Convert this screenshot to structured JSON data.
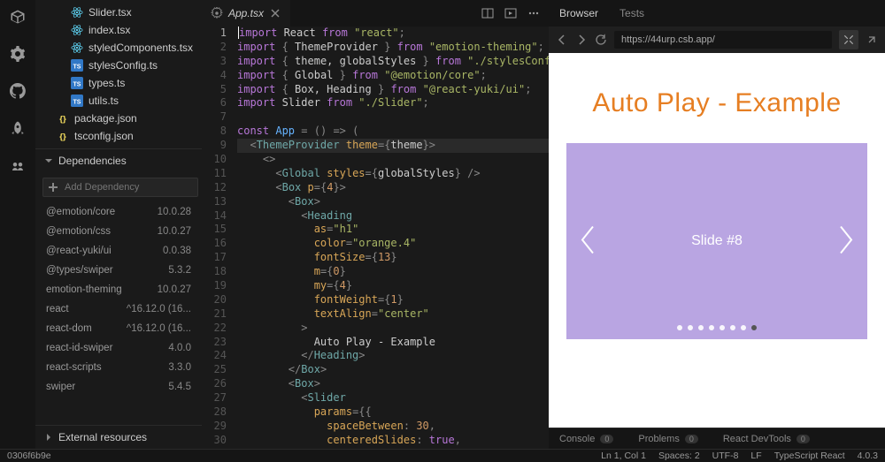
{
  "files": [
    {
      "name": "Slider.tsx",
      "type": "react"
    },
    {
      "name": "index.tsx",
      "type": "react"
    },
    {
      "name": "styledComponents.tsx",
      "type": "react"
    },
    {
      "name": "stylesConfig.ts",
      "type": "ts"
    },
    {
      "name": "types.ts",
      "type": "ts"
    },
    {
      "name": "utils.ts",
      "type": "ts"
    },
    {
      "name": "package.json",
      "type": "json",
      "lessIndent": true
    },
    {
      "name": "tsconfig.json",
      "type": "json",
      "lessIndent": true
    }
  ],
  "sections": {
    "deps": "Dependencies",
    "external": "External resources"
  },
  "depSearch": {
    "placeholder": "Add Dependency"
  },
  "dependencies": [
    {
      "name": "@emotion/core",
      "version": "10.0.28"
    },
    {
      "name": "@emotion/css",
      "version": "10.0.27"
    },
    {
      "name": "@react-yuki/ui",
      "version": "0.0.38"
    },
    {
      "name": "@types/swiper",
      "version": "5.3.2"
    },
    {
      "name": "emotion-theming",
      "version": "10.0.27"
    },
    {
      "name": "react",
      "version": "^16.12.0 (16..."
    },
    {
      "name": "react-dom",
      "version": "^16.12.0 (16..."
    },
    {
      "name": "react-id-swiper",
      "version": "4.0.0"
    },
    {
      "name": "react-scripts",
      "version": "3.3.0"
    },
    {
      "name": "swiper",
      "version": "5.4.5"
    }
  ],
  "tab": {
    "name": "App.tsx"
  },
  "code_lines": [
    [
      [
        "kw",
        "import"
      ],
      [
        "plain",
        " React "
      ],
      [
        "kw",
        "from"
      ],
      [
        "plain",
        " "
      ],
      [
        "str",
        "\"react\""
      ],
      [
        "punc",
        ";"
      ]
    ],
    [
      [
        "kw",
        "import"
      ],
      [
        "plain",
        " "
      ],
      [
        "punc",
        "{"
      ],
      [
        "plain",
        " ThemeProvider "
      ],
      [
        "punc",
        "}"
      ],
      [
        "plain",
        " "
      ],
      [
        "kw",
        "from"
      ],
      [
        "plain",
        " "
      ],
      [
        "str",
        "\"emotion-theming\""
      ],
      [
        "punc",
        ";"
      ]
    ],
    [
      [
        "kw",
        "import"
      ],
      [
        "plain",
        " "
      ],
      [
        "punc",
        "{"
      ],
      [
        "plain",
        " theme, globalStyles "
      ],
      [
        "punc",
        "}"
      ],
      [
        "plain",
        " "
      ],
      [
        "kw",
        "from"
      ],
      [
        "plain",
        " "
      ],
      [
        "str",
        "\"./stylesConfig\""
      ],
      [
        "punc",
        ";"
      ]
    ],
    [
      [
        "kw",
        "import"
      ],
      [
        "plain",
        " "
      ],
      [
        "punc",
        "{"
      ],
      [
        "plain",
        " Global "
      ],
      [
        "punc",
        "}"
      ],
      [
        "plain",
        " "
      ],
      [
        "kw",
        "from"
      ],
      [
        "plain",
        " "
      ],
      [
        "str",
        "\"@emotion/core\""
      ],
      [
        "punc",
        ";"
      ]
    ],
    [
      [
        "kw",
        "import"
      ],
      [
        "plain",
        " "
      ],
      [
        "punc",
        "{"
      ],
      [
        "plain",
        " Box, Heading "
      ],
      [
        "punc",
        "}"
      ],
      [
        "plain",
        " "
      ],
      [
        "kw",
        "from"
      ],
      [
        "plain",
        " "
      ],
      [
        "str",
        "\"@react-yuki/ui\""
      ],
      [
        "punc",
        ";"
      ]
    ],
    [
      [
        "kw",
        "import"
      ],
      [
        "plain",
        " Slider "
      ],
      [
        "kw",
        "from"
      ],
      [
        "plain",
        " "
      ],
      [
        "str",
        "\"./Slider\""
      ],
      [
        "punc",
        ";"
      ]
    ],
    [
      [
        "plain",
        ""
      ]
    ],
    [
      [
        "kw",
        "const"
      ],
      [
        "plain",
        " "
      ],
      [
        "fn",
        "App"
      ],
      [
        "plain",
        " "
      ],
      [
        "punc",
        "="
      ],
      [
        "plain",
        " "
      ],
      [
        "punc",
        "()"
      ],
      [
        "plain",
        " "
      ],
      [
        "punc",
        "=>"
      ],
      [
        "plain",
        " "
      ],
      [
        "punc",
        "("
      ]
    ],
    [
      [
        "plain",
        "  "
      ],
      [
        "punc",
        "<"
      ],
      [
        "comp",
        "ThemeProvider"
      ],
      [
        "plain",
        " "
      ],
      [
        "attr",
        "theme"
      ],
      [
        "punc",
        "={"
      ],
      [
        "plain",
        "theme"
      ],
      [
        "punc",
        "}>"
      ]
    ],
    [
      [
        "plain",
        "    "
      ],
      [
        "punc",
        "<>"
      ]
    ],
    [
      [
        "plain",
        "      "
      ],
      [
        "punc",
        "<"
      ],
      [
        "comp",
        "Global"
      ],
      [
        "plain",
        " "
      ],
      [
        "attr",
        "styles"
      ],
      [
        "punc",
        "={"
      ],
      [
        "plain",
        "globalStyles"
      ],
      [
        "punc",
        "}"
      ],
      [
        "plain",
        " "
      ],
      [
        "punc",
        "/>"
      ]
    ],
    [
      [
        "plain",
        "      "
      ],
      [
        "punc",
        "<"
      ],
      [
        "comp",
        "Box"
      ],
      [
        "plain",
        " "
      ],
      [
        "attr",
        "p"
      ],
      [
        "punc",
        "={"
      ],
      [
        "num",
        "4"
      ],
      [
        "punc",
        "}>"
      ]
    ],
    [
      [
        "plain",
        "        "
      ],
      [
        "punc",
        "<"
      ],
      [
        "comp",
        "Box"
      ],
      [
        "punc",
        ">"
      ]
    ],
    [
      [
        "plain",
        "          "
      ],
      [
        "punc",
        "<"
      ],
      [
        "comp",
        "Heading"
      ]
    ],
    [
      [
        "plain",
        "            "
      ],
      [
        "attr",
        "as"
      ],
      [
        "punc",
        "="
      ],
      [
        "str",
        "\"h1\""
      ]
    ],
    [
      [
        "plain",
        "            "
      ],
      [
        "attr",
        "color"
      ],
      [
        "punc",
        "="
      ],
      [
        "str",
        "\"orange.4\""
      ]
    ],
    [
      [
        "plain",
        "            "
      ],
      [
        "attr",
        "fontSize"
      ],
      [
        "punc",
        "={"
      ],
      [
        "num",
        "13"
      ],
      [
        "punc",
        "}"
      ]
    ],
    [
      [
        "plain",
        "            "
      ],
      [
        "attr",
        "m"
      ],
      [
        "punc",
        "={"
      ],
      [
        "num",
        "0"
      ],
      [
        "punc",
        "}"
      ]
    ],
    [
      [
        "plain",
        "            "
      ],
      [
        "attr",
        "my"
      ],
      [
        "punc",
        "={"
      ],
      [
        "num",
        "4"
      ],
      [
        "punc",
        "}"
      ]
    ],
    [
      [
        "plain",
        "            "
      ],
      [
        "attr",
        "fontWeight"
      ],
      [
        "punc",
        "={"
      ],
      [
        "num",
        "1"
      ],
      [
        "punc",
        "}"
      ]
    ],
    [
      [
        "plain",
        "            "
      ],
      [
        "attr",
        "textAlign"
      ],
      [
        "punc",
        "="
      ],
      [
        "str",
        "\"center\""
      ]
    ],
    [
      [
        "plain",
        "          "
      ],
      [
        "punc",
        ">"
      ]
    ],
    [
      [
        "plain",
        "            Auto Play - Example"
      ]
    ],
    [
      [
        "plain",
        "          "
      ],
      [
        "punc",
        "</"
      ],
      [
        "comp",
        "Heading"
      ],
      [
        "punc",
        ">"
      ]
    ],
    [
      [
        "plain",
        "        "
      ],
      [
        "punc",
        "</"
      ],
      [
        "comp",
        "Box"
      ],
      [
        "punc",
        ">"
      ]
    ],
    [
      [
        "plain",
        "        "
      ],
      [
        "punc",
        "<"
      ],
      [
        "comp",
        "Box"
      ],
      [
        "punc",
        ">"
      ]
    ],
    [
      [
        "plain",
        "          "
      ],
      [
        "punc",
        "<"
      ],
      [
        "comp",
        "Slider"
      ]
    ],
    [
      [
        "plain",
        "            "
      ],
      [
        "attr",
        "params"
      ],
      [
        "punc",
        "={{"
      ]
    ],
    [
      [
        "plain",
        "              "
      ],
      [
        "attr",
        "spaceBetween"
      ],
      [
        "punc",
        ":"
      ],
      [
        "plain",
        " "
      ],
      [
        "num",
        "30"
      ],
      [
        "punc",
        ","
      ]
    ],
    [
      [
        "plain",
        "              "
      ],
      [
        "attr",
        "centeredSlides"
      ],
      [
        "punc",
        ":"
      ],
      [
        "plain",
        " "
      ],
      [
        "kw",
        "true"
      ],
      [
        "punc",
        ","
      ]
    ]
  ],
  "preview": {
    "tabs": {
      "browser": "Browser",
      "tests": "Tests"
    },
    "url": "https://44urp.csb.app/",
    "title": "Auto Play - Example",
    "slideText": "Slide #8",
    "dotCount": 8,
    "activeDot": 7
  },
  "console": {
    "console": "Console",
    "problems": "Problems",
    "devtools": "React DevTools",
    "badge": "0"
  },
  "status": {
    "hash": "0306f6b9e",
    "pos": "Ln 1, Col 1",
    "spaces": "Spaces: 2",
    "encoding": "UTF-8",
    "eol": "LF",
    "lang": "TypeScript React",
    "ver": "4.0.3"
  }
}
